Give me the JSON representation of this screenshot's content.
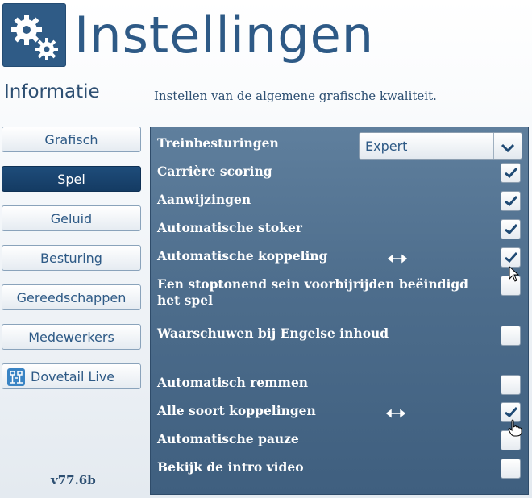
{
  "header": {
    "title": "Instellingen",
    "logo_icon": "gears-icon"
  },
  "info": {
    "title": "Informatie",
    "description": "Instellen van de algemene grafische kwaliteit."
  },
  "nav": {
    "items": [
      {
        "label": "Grafisch",
        "active": false
      },
      {
        "label": "Spel",
        "active": true
      },
      {
        "label": "Geluid",
        "active": false
      },
      {
        "label": "Besturing",
        "active": false
      },
      {
        "label": "Gereedschappen",
        "active": false
      },
      {
        "label": "Medewerkers",
        "active": false
      },
      {
        "label": "Dovetail Live",
        "active": false,
        "icon": "dovetail-live-icon"
      }
    ]
  },
  "version": "v77.6b",
  "settings": {
    "dropdown": {
      "label": "Treinbesturingen",
      "value": "Expert"
    },
    "rows": [
      {
        "label": "Carrière scoring",
        "checked": true
      },
      {
        "label": "Aanwijzingen",
        "checked": true
      },
      {
        "label": "Automatische stoker",
        "checked": true
      },
      {
        "label": "Automatische koppeling",
        "checked": true
      },
      {
        "label_line1": "Een stoptonend sein voorbijrijden beëindigd",
        "label_line2": "het spel",
        "checked": false
      },
      {
        "label": "Waarschuwen bij Engelse inhoud",
        "checked": false
      },
      {
        "label": "Automatisch remmen",
        "checked": false
      },
      {
        "label": "Alle soort koppelingen",
        "checked": true
      },
      {
        "label": "Automatische pauze",
        "checked": false
      },
      {
        "label": "Bekijk de intro video",
        "checked": false
      }
    ]
  },
  "colors": {
    "brand": "#2e5a86",
    "active_nav": "#143b63",
    "panel": "#4d6d8c"
  }
}
